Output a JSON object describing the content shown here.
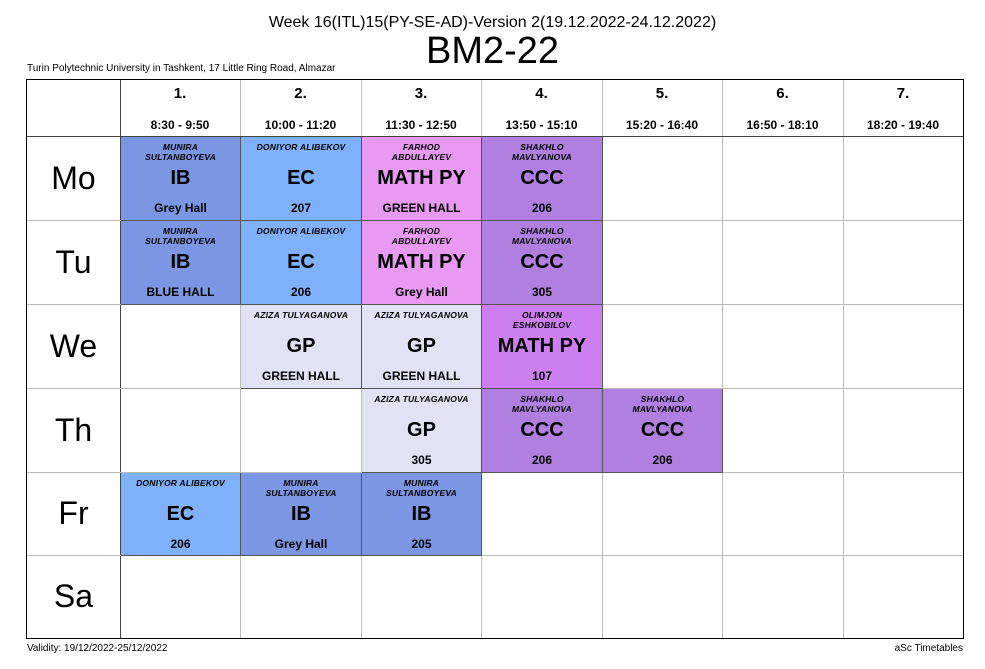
{
  "header": {
    "week_title": "Week 16(ITL)15(PY-SE-AD)-Version 2(19.12.2022-24.12.2022)",
    "class_name": "BM2-22",
    "school": "Turin Polytechnic University in Tashkent, 17 Little Ring Road, Almazar"
  },
  "periods": [
    {
      "num": "1.",
      "time": "8:30 - 9:50"
    },
    {
      "num": "2.",
      "time": "10:00 - 11:20"
    },
    {
      "num": "3.",
      "time": "11:30 - 12:50"
    },
    {
      "num": "4.",
      "time": "13:50 - 15:10"
    },
    {
      "num": "5.",
      "time": "15:20 - 16:40"
    },
    {
      "num": "6.",
      "time": "16:50 - 18:10"
    },
    {
      "num": "7.",
      "time": "18:20 - 19:40"
    }
  ],
  "days": [
    "Mo",
    "Tu",
    "We",
    "Th",
    "Fr",
    "Sa"
  ],
  "lessons": [
    {
      "day": 0,
      "period": 0,
      "teacher": [
        "MUNIRA",
        "SULTANBOYEVA"
      ],
      "subject": "IB",
      "room": "Grey Hall",
      "color": "#7b96e2"
    },
    {
      "day": 0,
      "period": 1,
      "teacher": [
        "DONIYOR  ALIBEKOV"
      ],
      "subject": "EC",
      "room": "207",
      "color": "#7fb0fb"
    },
    {
      "day": 0,
      "period": 2,
      "teacher": [
        "FARHOD",
        "ABDULLAYEV"
      ],
      "subject": "MATH PY",
      "room": "GREEN HALL",
      "color": "#e89af3"
    },
    {
      "day": 0,
      "period": 3,
      "teacher": [
        "SHAKHLO",
        "MAVLYANOVA"
      ],
      "subject": "CCC",
      "room": "206",
      "color": "#b07fe0"
    },
    {
      "day": 1,
      "period": 0,
      "teacher": [
        "MUNIRA",
        "SULTANBOYEVA"
      ],
      "subject": "IB",
      "room": "BLUE HALL",
      "color": "#7b96e2"
    },
    {
      "day": 1,
      "period": 1,
      "teacher": [
        "DONIYOR  ALIBEKOV"
      ],
      "subject": "EC",
      "room": "206",
      "color": "#7fb0fb"
    },
    {
      "day": 1,
      "period": 2,
      "teacher": [
        "FARHOD",
        "ABDULLAYEV"
      ],
      "subject": "MATH PY",
      "room": "Grey Hall",
      "color": "#e89af3"
    },
    {
      "day": 1,
      "period": 3,
      "teacher": [
        "SHAKHLO",
        "MAVLYANOVA"
      ],
      "subject": "CCC",
      "room": "305",
      "color": "#b07fe0"
    },
    {
      "day": 2,
      "period": 1,
      "teacher": [
        "AZIZA TULYAGANOVA"
      ],
      "subject": "GP",
      "room": "GREEN HALL",
      "color": "#e2e2f6"
    },
    {
      "day": 2,
      "period": 2,
      "teacher": [
        "AZIZA TULYAGANOVA"
      ],
      "subject": "GP",
      "room": "GREEN HALL",
      "color": "#e2e2f6"
    },
    {
      "day": 2,
      "period": 3,
      "teacher": [
        "OLIMJON",
        "ESHKOBILOV"
      ],
      "subject": "MATH PY",
      "room": "107",
      "color": "#cd7ef0"
    },
    {
      "day": 3,
      "period": 2,
      "teacher": [
        "AZIZA TULYAGANOVA"
      ],
      "subject": "GP",
      "room": "305",
      "color": "#e2e2f6"
    },
    {
      "day": 3,
      "period": 3,
      "teacher": [
        "SHAKHLO",
        "MAVLYANOVA"
      ],
      "subject": "CCC",
      "room": "206",
      "color": "#b07fe0"
    },
    {
      "day": 3,
      "period": 4,
      "teacher": [
        "SHAKHLO",
        "MAVLYANOVA"
      ],
      "subject": "CCC",
      "room": "206",
      "color": "#b07fe0"
    },
    {
      "day": 4,
      "period": 0,
      "teacher": [
        "DONIYOR  ALIBEKOV"
      ],
      "subject": "EC",
      "room": "206",
      "color": "#7fb0fb"
    },
    {
      "day": 4,
      "period": 1,
      "teacher": [
        "MUNIRA",
        "SULTANBOYEVA"
      ],
      "subject": "IB",
      "room": "Grey Hall",
      "color": "#7b96e2"
    },
    {
      "day": 4,
      "period": 2,
      "teacher": [
        "MUNIRA",
        "SULTANBOYEVA"
      ],
      "subject": "IB",
      "room": "205",
      "color": "#7b96e2"
    }
  ],
  "footer": {
    "validity": "Validity: 19/12/2022-25/12/2022",
    "brand": "aSc Timetables"
  }
}
